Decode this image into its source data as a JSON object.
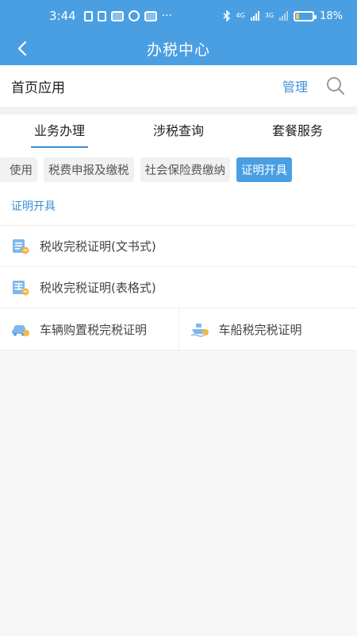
{
  "status_bar": {
    "time": "3:44",
    "more": "···",
    "battery": "18%",
    "battery_level": 0.18,
    "network": "4G",
    "network2": "3G"
  },
  "nav": {
    "title": "办税中心"
  },
  "home_apps": {
    "label": "首页应用",
    "manage": "管理"
  },
  "tabs": [
    {
      "label": "业务办理",
      "active": true
    },
    {
      "label": "涉税查询",
      "active": false
    },
    {
      "label": "套餐服务",
      "active": false
    }
  ],
  "chips": [
    {
      "label": "使用"
    },
    {
      "label": "税费申报及缴税"
    },
    {
      "label": "社会保险费缴纳"
    },
    {
      "label": "证明开具",
      "active": true
    }
  ],
  "section": {
    "title": "证明开具"
  },
  "items": [
    {
      "label": "税收完税证明(文书式)",
      "icon": "document-certificate-icon"
    },
    {
      "label": "税收完税证明(表格式)",
      "icon": "table-certificate-icon"
    },
    {
      "label": "车辆购置税完税证明",
      "icon": "car-icon"
    },
    {
      "label": "车船税完税证明",
      "icon": "ship-icon"
    }
  ],
  "colors": {
    "primary": "#4a9fe3",
    "accent": "#3b8fd6",
    "coin": "#f2b84b"
  }
}
